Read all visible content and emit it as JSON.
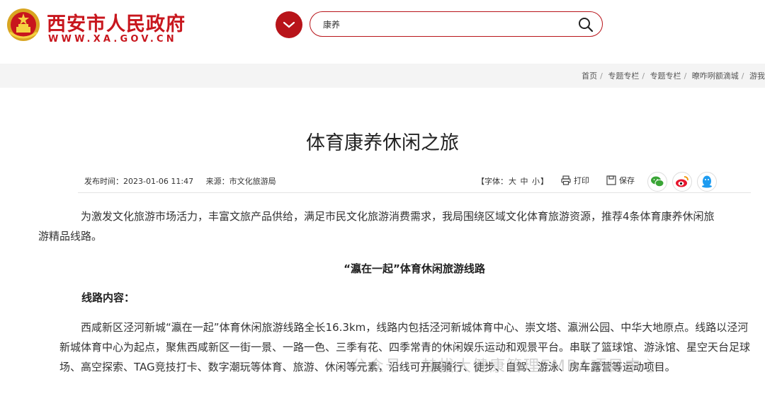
{
  "header": {
    "site_title": "西安市人民政府",
    "site_url": "WWW.XA.GOV.CN",
    "search": {
      "value": "康养"
    },
    "brand_color": "#c8161d"
  },
  "breadcrumb": [
    "首页",
    "专题专栏",
    "专题专栏",
    "暸咋咧额滴城",
    "游我"
  ],
  "article": {
    "title": "体育康养休闲之旅",
    "publish_time": "发布时间：2023-01-06 11:47",
    "source": "来源：市文化旅游局",
    "font_size_label": "【字体：",
    "font_large": "大",
    "font_medium": "中",
    "font_small": "小",
    "font_size_close": "】",
    "print_label": "打印",
    "save_label": "保存",
    "intro_line1": "为激发文化旅游市场活力，丰富文旅产品供给，满足市民文化旅游消费需求，我局围绕区域文化体育旅游资源，推荐4条体育康养休闲旅",
    "intro_line2": "游精品线路。",
    "route_title": "“瀛在一起”体育休闲旅游线路",
    "route_content_label": "线路内容：",
    "route_text": "西咸新区泾河新城“瀛在一起”体育休闲旅游线路全长16.3km，线路内包括泾河新城体育中心、崇文塔、瀛洲公园、中华大地原点。线路以泾河新城体育中心为起点，聚焦西咸新区一街一景、一路一色、三季有花、四季常青的休闲娱乐运动和观景平台。串联了篮球馆、游泳馆、星空天台足球场、高空探索、TAG竞技打卡、数字潮玩等体育、旅游、休闲等元素，沿线可开展骑行、徒步、自驾、游泳、房车露营等运动项目。"
  },
  "watermark": "公众号 · 赫拔大健康管理EMBA项目中心"
}
